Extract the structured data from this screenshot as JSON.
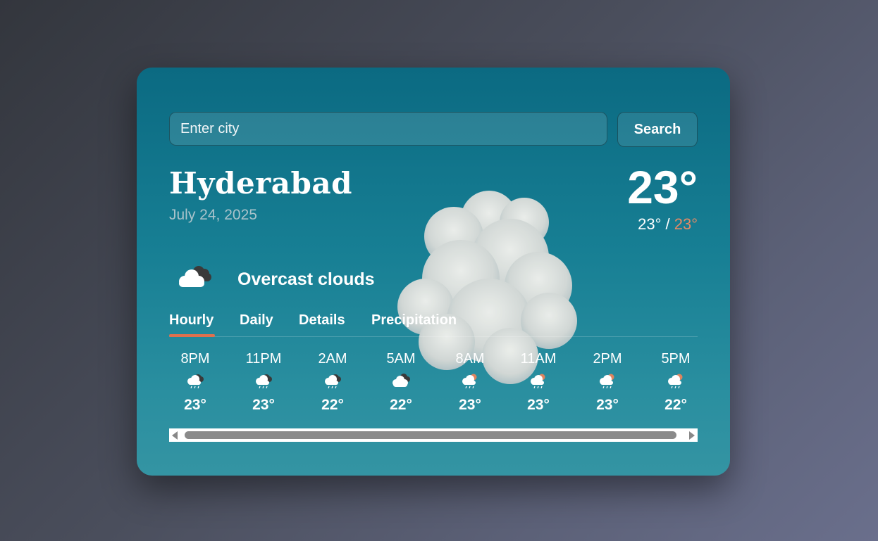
{
  "search": {
    "placeholder": "Enter city",
    "button_label": "Search"
  },
  "location": {
    "city": "Hyderabad",
    "date": "July 24, 2025"
  },
  "current": {
    "temp": "23°",
    "low": "23°",
    "separator": " / ",
    "high": "23°",
    "condition": "Overcast clouds",
    "condition_icon": "overcast-cloud-icon"
  },
  "tabs": [
    {
      "label": "Hourly",
      "active": true
    },
    {
      "label": "Daily",
      "active": false
    },
    {
      "label": "Details",
      "active": false
    },
    {
      "label": "Precipitation",
      "active": false
    }
  ],
  "hourly": [
    {
      "time": "8PM",
      "temp": "23°",
      "icon": "cloud-rain-night-icon"
    },
    {
      "time": "11PM",
      "temp": "23°",
      "icon": "cloud-rain-night-icon"
    },
    {
      "time": "2AM",
      "temp": "22°",
      "icon": "cloud-rain-night-icon"
    },
    {
      "time": "5AM",
      "temp": "22°",
      "icon": "overcast-cloud-icon"
    },
    {
      "time": "8AM",
      "temp": "23°",
      "icon": "cloud-rain-day-icon"
    },
    {
      "time": "11AM",
      "temp": "23°",
      "icon": "cloud-rain-day-icon"
    },
    {
      "time": "2PM",
      "temp": "23°",
      "icon": "cloud-rain-day-icon"
    },
    {
      "time": "5PM",
      "temp": "22°",
      "icon": "cloud-rain-day-icon"
    }
  ],
  "colors": {
    "accent": "#e0704d",
    "card": "#177f94",
    "high_temp": "#e38a66"
  }
}
